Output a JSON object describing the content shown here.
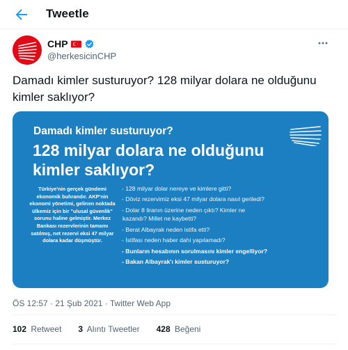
{
  "header": {
    "title": "Tweetle"
  },
  "author": {
    "name": "CHP",
    "handle": "@herkesicinCHP"
  },
  "tweet": {
    "text": "Damadı kimler susturuyor? 128 milyar dolara ne olduğunu kimler saklıyor?"
  },
  "media": {
    "subtitle": "Damadı kimler susturuyor?",
    "headline_1": "128 milyar dolara ne olduğunu",
    "headline_2": "kimler saklıyor?",
    "left_text": "Türkiye'nin gerçek gündemi ekonomik buhrandır. AKP'nin ekonomi yönetimi, gelinen noktada ülkemiz için bir \"ulusal güvenlik\" sorunu haline gelmiştir. Merkez Bankası rezervlerinin tamamı satılmış, net rezervi eksi 47 milyar dolara kadar düşmüştür.",
    "questions": [
      "- 128 milyar dolar nereye ve kimlere gitti?",
      "- Döviz rezervimiz eksi 47 milyar dolara nasıl geriledi?",
      "- Dolar 8 liranın üzerine neden çıktı? Kimler ne",
      "kazandı? Millet ne kaybetti?",
      "- Berat Albayrak neden istifa etti?",
      "- İstifası neden haber dahi yapılamadı?",
      "- Bunların hesabının sorulmasını kimler engelliyor?",
      "- Bakan Albayrak'ı kimler susturuyor?"
    ]
  },
  "meta": {
    "timestamp": "ÖS 12:57 · 21 Şub 2021 · Twitter Web App"
  },
  "stats": {
    "retweets": "102",
    "retweets_label": "Retweet",
    "quotes": "3",
    "quotes_label": "Alıntı Tweetler",
    "likes": "428",
    "likes_label": "Beğeni"
  },
  "colors": {
    "accent": "#1d9bf0",
    "media_bg": "#1c7fc2",
    "brand_red": "#e30a17"
  },
  "icons": [
    "back-arrow-icon",
    "verified-badge-icon",
    "turkey-flag-icon",
    "more-options-icon",
    "chp-logo-icon"
  ]
}
